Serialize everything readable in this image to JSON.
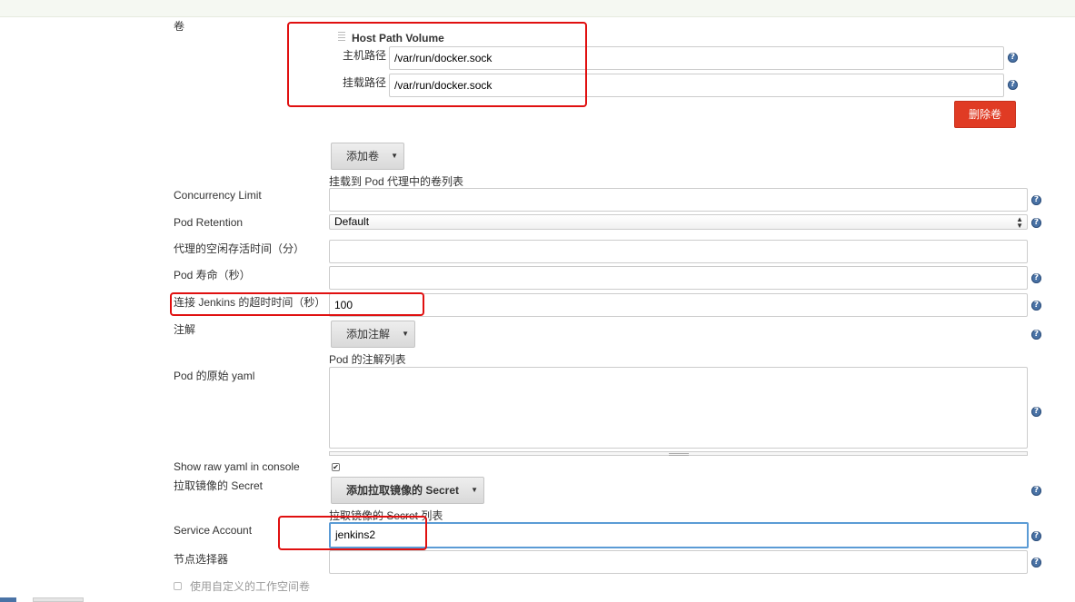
{
  "volumes": {
    "section_label": "卷",
    "host_path_volume": {
      "title": "Host Path Volume",
      "host_path_label": "主机路径",
      "host_path_value": "/var/run/docker.sock",
      "mount_path_label": "挂载路径",
      "mount_path_value": "/var/run/docker.sock",
      "delete_label": "删除卷"
    },
    "add_label": "添加卷",
    "hint": "挂载到 Pod 代理中的卷列表"
  },
  "form": {
    "concurrency_limit_label": "Concurrency Limit",
    "concurrency_limit_value": "",
    "pod_retention_label": "Pod Retention",
    "pod_retention_value": "Default",
    "idle_minutes_label": "代理的空闲存活时间（分）",
    "idle_minutes_value": "",
    "pod_lifetime_label": "Pod 寿命（秒）",
    "pod_lifetime_value": "",
    "jenkins_timeout_label": "连接 Jenkins 的超时时间（秒）",
    "jenkins_timeout_value": "100",
    "annotations_label": "注解",
    "add_annotation_label": "添加注解",
    "annotations_hint": "Pod 的注解列表",
    "raw_yaml_label": "Pod 的原始 yaml",
    "raw_yaml_value": "",
    "show_raw_yaml_label": "Show raw yaml in console",
    "show_raw_yaml_checked": true,
    "image_pull_secret_label": "拉取镜像的 Secret",
    "add_image_pull_secret_label": "添加拉取镜像的 Secret",
    "image_pull_secret_hint": "拉取镜像的 Secret 列表",
    "service_account_label": "Service Account",
    "service_account_value": "jenkins2",
    "node_selector_label": "节点选择器",
    "node_selector_value": "",
    "custom_workspace_label": "使用自定义的工作空间卷"
  },
  "icons": {
    "help": "?",
    "caret": "▼",
    "check": "✔",
    "select_up": "▲",
    "select_down": "▼"
  },
  "colors": {
    "delete_button": "#e03b24",
    "highlight_box": "#e01010",
    "focus_border": "#5b9bd5",
    "help_icon": "#4a73a6"
  }
}
